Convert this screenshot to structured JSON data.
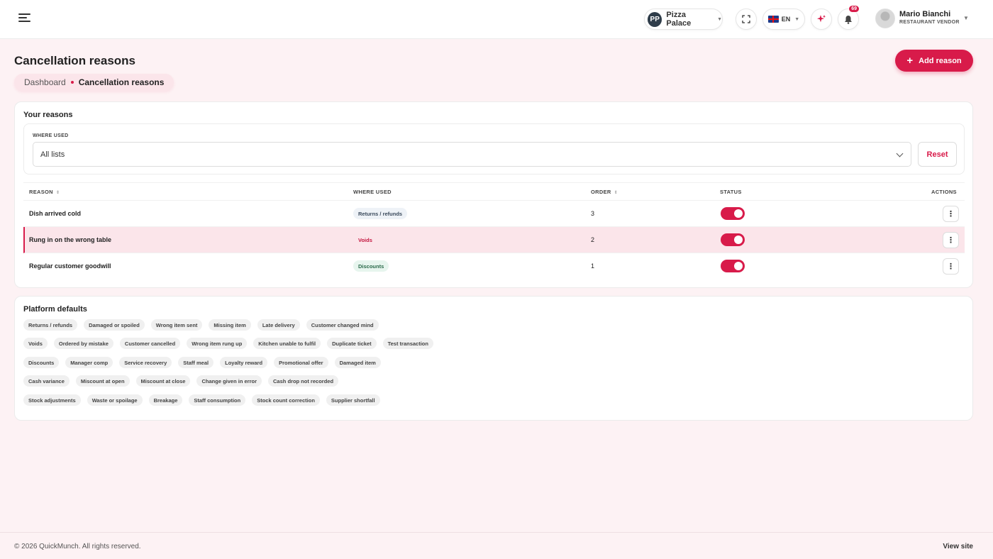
{
  "header": {
    "store": {
      "initials": "PP",
      "name": "Pizza Palace"
    },
    "language": "EN",
    "notification_count": "69",
    "user": {
      "name": "Mario Bianchi",
      "role": "RESTAURANT VENDOR"
    }
  },
  "page": {
    "title": "Cancellation reasons",
    "breadcrumb": {
      "home": "Dashboard",
      "current": "Cancellation reasons"
    },
    "add_button": "Add reason"
  },
  "reasons_card": {
    "title": "Your reasons",
    "filter_label": "WHERE USED",
    "filter_value": "All lists",
    "reset_label": "Reset",
    "columns": {
      "reason": "REASON",
      "where_used": "WHERE USED",
      "order": "ORDER",
      "status": "STATUS",
      "actions": "ACTIONS"
    },
    "rows": [
      {
        "reason": "Dish arrived cold",
        "where_used": "Returns / refunds",
        "order": "3",
        "status": "on"
      },
      {
        "reason": "Rung in on the wrong table",
        "where_used": "Voids",
        "order": "2",
        "status": "on"
      },
      {
        "reason": "Regular customer goodwill",
        "where_used": "Discounts",
        "order": "1",
        "status": "on"
      }
    ]
  },
  "defaults_card": {
    "title": "Platform defaults",
    "groups": [
      {
        "category": "Returns / refunds",
        "items": [
          "Damaged or spoiled",
          "Wrong item sent",
          "Missing item",
          "Late delivery",
          "Customer changed mind"
        ]
      },
      {
        "category": "Voids",
        "items": [
          "Ordered by mistake",
          "Customer cancelled",
          "Wrong item rung up",
          "Kitchen unable to fulfil",
          "Duplicate ticket",
          "Test transaction"
        ]
      },
      {
        "category": "Discounts",
        "items": [
          "Manager comp",
          "Service recovery",
          "Staff meal",
          "Loyalty reward",
          "Promotional offer",
          "Damaged item"
        ]
      },
      {
        "category": "Cash variance",
        "items": [
          "Miscount at open",
          "Miscount at close",
          "Change given in error",
          "Cash drop not recorded"
        ]
      },
      {
        "category": "Stock adjustments",
        "items": [
          "Waste or spoilage",
          "Breakage",
          "Staff consumption",
          "Stock count correction",
          "Supplier shortfall"
        ]
      }
    ]
  },
  "footer": {
    "copyright": "© 2026 QuickMunch. All rights reserved.",
    "link": "View site"
  },
  "colors": {
    "accent": "#d81b4a",
    "background": "#fdf2f4"
  }
}
